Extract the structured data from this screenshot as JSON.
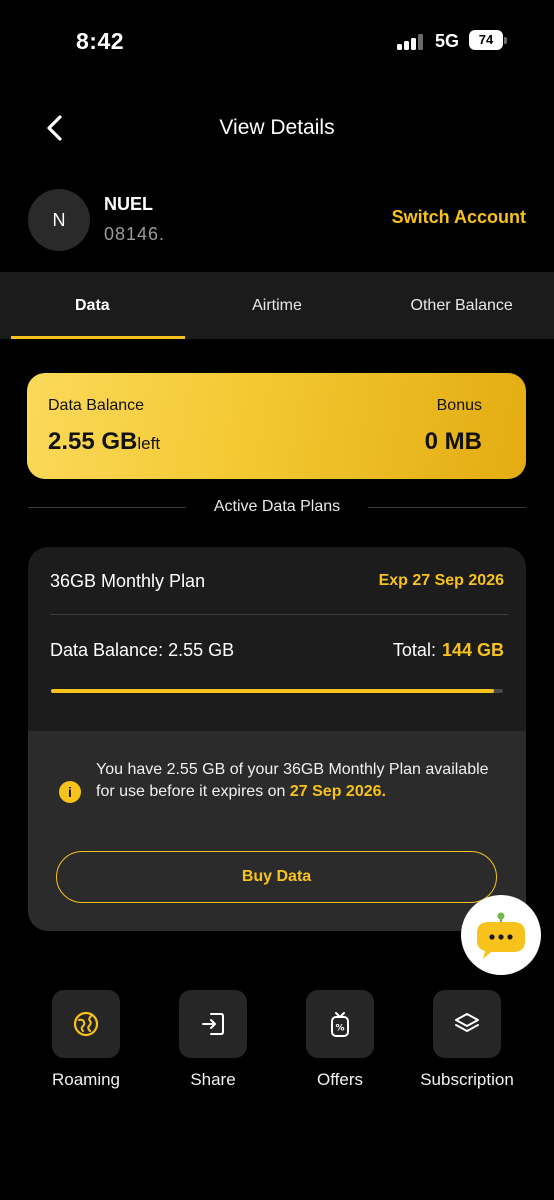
{
  "status_bar": {
    "time": "8:42",
    "network": "5G",
    "battery": "74"
  },
  "header": {
    "title": "View Details"
  },
  "account": {
    "initial": "N",
    "name": "NUEL",
    "number": "08146.",
    "switch_label": "Switch Account"
  },
  "tabs": [
    {
      "label": "Data",
      "active": true
    },
    {
      "label": "Airtime",
      "active": false
    },
    {
      "label": "Other Balance",
      "active": false
    }
  ],
  "balance": {
    "label": "Data Balance",
    "value": "2.55 GB",
    "value_suffix": "left",
    "bonus_label": "Bonus",
    "bonus_value": "0 MB"
  },
  "section_title": "Active Data Plans",
  "plan": {
    "name": "36GB Monthly Plan",
    "expiry": "Exp 27 Sep 2026",
    "balance_text": "Data Balance: 2.55 GB",
    "total_label": "Total:",
    "total_value": "144 GB",
    "progress_fraction": 0.98,
    "info_text": "You have 2.55 GB of your 36GB Monthly Plan available for use before it expires on",
    "info_date": "27 Sep 2026.",
    "buy_label": "Buy Data"
  },
  "quick_actions": [
    {
      "label": "Roaming",
      "icon": "roaming-icon"
    },
    {
      "label": "Share",
      "icon": "share-icon"
    },
    {
      "label": "Offers",
      "icon": "offers-icon"
    },
    {
      "label": "Subscription",
      "icon": "subscription-icon"
    }
  ],
  "colors": {
    "accent": "#f7c21c",
    "background": "#000000",
    "card": "#1c1c1c"
  }
}
